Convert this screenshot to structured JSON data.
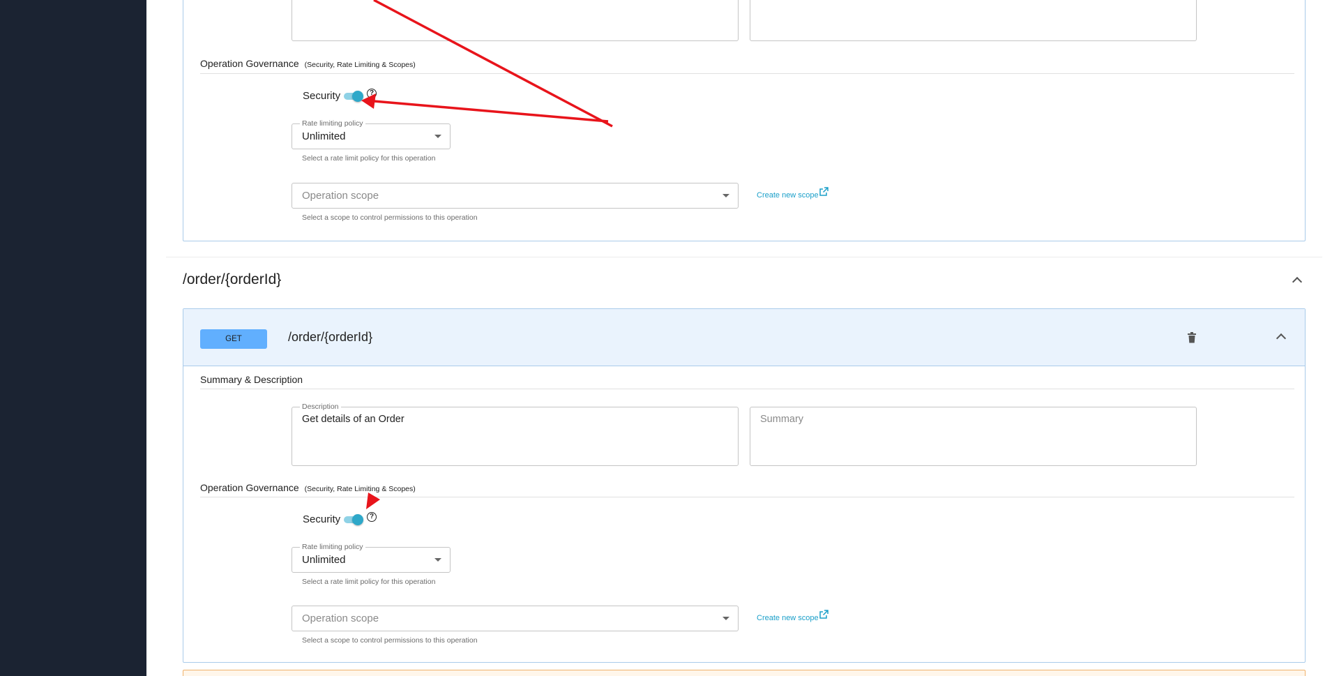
{
  "top_section": {
    "governance_title": "Operation Governance",
    "governance_subtitle": "(Security, Rate Limiting & Scopes)",
    "security_label": "Security",
    "rate_limit_legend": "Rate limiting policy",
    "rate_limit_value": "Unlimited",
    "rate_limit_helper": "Select a rate limit policy for this operation",
    "scope_placeholder": "Operation scope",
    "scope_helper": "Select a scope to control permissions to this operation",
    "create_scope_link": "Create new scope"
  },
  "resource": {
    "path_heading": "/order/{orderId}",
    "operation": {
      "method": "GET",
      "path": "/order/{orderId}",
      "summary_section_title": "Summary & Description",
      "description_legend": "Description",
      "description_value": "Get details of an Order",
      "summary_placeholder": "Summary",
      "governance_title": "Operation Governance",
      "governance_subtitle": "(Security, Rate Limiting & Scopes)",
      "security_label": "Security",
      "rate_limit_legend": "Rate limiting policy",
      "rate_limit_value": "Unlimited",
      "rate_limit_helper": "Select a rate limit policy for this operation",
      "scope_placeholder": "Operation scope",
      "scope_helper": "Select a scope to control permissions to this operation",
      "create_scope_link": "Create new scope"
    }
  },
  "icons": {
    "help": "help-circle-icon",
    "external_link": "open-in-new-icon",
    "delete": "trash-icon",
    "collapse": "chevron-up-icon",
    "dropdown": "caret-down-icon"
  },
  "colors": {
    "sidebar": "#1b2332",
    "panel_border": "#a9cbea",
    "header_bg": "#eaf3fd",
    "get_badge": "#61affe",
    "toggle_on": "#2ea8c9",
    "link": "#1a9fc9",
    "annotation_arrow": "#e8141b"
  }
}
